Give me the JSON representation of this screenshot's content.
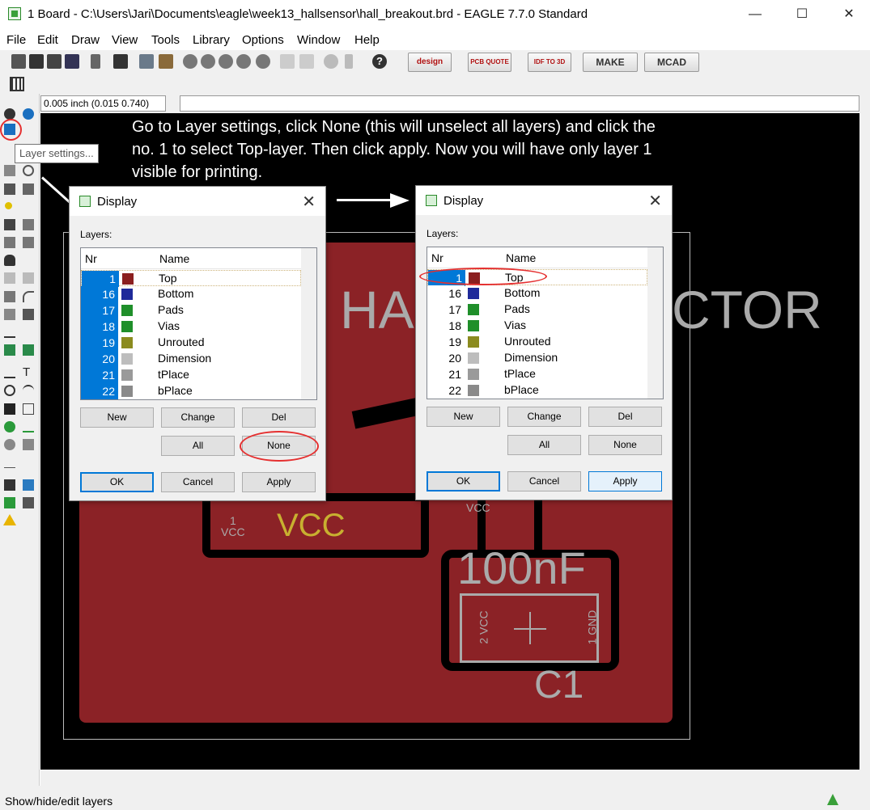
{
  "window": {
    "title": "1 Board - C:\\Users\\Jari\\Documents\\eagle\\week13_hallsensor\\hall_breakout.brd - EAGLE 7.7.0 Standard"
  },
  "menu": [
    "File",
    "Edit",
    "Draw",
    "View",
    "Tools",
    "Library",
    "Options",
    "Window",
    "Help"
  ],
  "toolbar": {
    "buttons": [
      "design link",
      "PCB QUOTE",
      "IDF TO 3D",
      "MAKE",
      "MCAD"
    ]
  },
  "grid_field": "0.005 inch (0.015 0.740)",
  "tooltip": "Layer settings...",
  "instruction": "Go to Layer settings, click None (this will unselect all layers) and click the no. 1 to select Top-layer. Then click apply. Now you will have only layer 1 visible for printing.",
  "pcb": {
    "title_left": "HA",
    "title_right": "CTOR",
    "vcc_label": "VCC",
    "vcc_small": "VCC",
    "pad_num": "1",
    "cap_value": "100nF",
    "cap_name": "C1",
    "pin2": "2 VCC",
    "pin1": "1 GND",
    "vcc_top": "VCC"
  },
  "dialog": {
    "title": "Display",
    "layers_label": "Layers:",
    "col_nr": "Nr",
    "col_name": "Name",
    "layers": [
      {
        "nr": "1",
        "name": "Top",
        "color": "#8b1f1f"
      },
      {
        "nr": "16",
        "name": "Bottom",
        "color": "#1f2a9a"
      },
      {
        "nr": "17",
        "name": "Pads",
        "color": "#1f8f2a"
      },
      {
        "nr": "18",
        "name": "Vias",
        "color": "#1f8f2a"
      },
      {
        "nr": "19",
        "name": "Unrouted",
        "color": "#8b8b1f"
      },
      {
        "nr": "20",
        "name": "Dimension",
        "color": "#bdbdbd"
      },
      {
        "nr": "21",
        "name": "tPlace",
        "color": "#9a9a9a"
      },
      {
        "nr": "22",
        "name": "bPlace",
        "color": "#8a8a8a"
      }
    ],
    "btn_new": "New",
    "btn_change": "Change",
    "btn_del": "Del",
    "btn_all": "All",
    "btn_none": "None",
    "btn_ok": "OK",
    "btn_cancel": "Cancel",
    "btn_apply": "Apply"
  },
  "status": "Show/hide/edit layers",
  "colors": {
    "accent": "#0078d7",
    "pcb_copper": "#8b2226",
    "annotation_red": "#e53030"
  }
}
